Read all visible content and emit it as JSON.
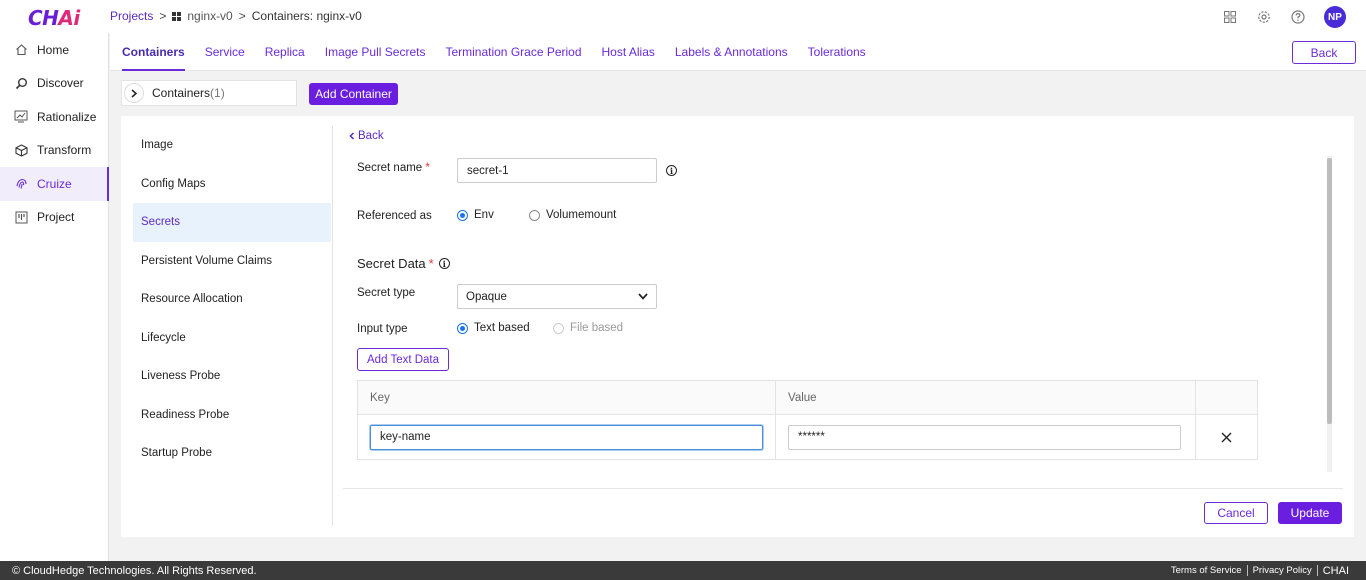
{
  "app": {
    "logo_main": "CH",
    "logo_accent": "Ai"
  },
  "breadcrumb": {
    "projects": "Projects",
    "sep1": ">",
    "project": "nginx-v0",
    "sep2": ">",
    "current": "Containers: nginx-v0"
  },
  "header": {
    "avatar_initials": "NP",
    "icons": [
      "grid-apps-icon",
      "gear-icon",
      "help-icon"
    ]
  },
  "sidebar": {
    "items": [
      {
        "label": "Home",
        "icon": "home-icon"
      },
      {
        "label": "Discover",
        "icon": "search-icon"
      },
      {
        "label": "Rationalize",
        "icon": "chart-icon"
      },
      {
        "label": "Transform",
        "icon": "cube-icon"
      },
      {
        "label": "Cruize",
        "icon": "fingerprint-icon",
        "active": true
      },
      {
        "label": "Project",
        "icon": "kanban-icon"
      }
    ]
  },
  "tabs": {
    "items": [
      "Containers",
      "Service",
      "Replica",
      "Image Pull Secrets",
      "Termination Grace Period",
      "Host Alias",
      "Labels & Annotations",
      "Tolerations"
    ],
    "active": "Containers",
    "back_label": "Back"
  },
  "containers": {
    "label": "Containers",
    "count": "(1)",
    "add_label": "Add Container"
  },
  "subnav": {
    "items": [
      "Image",
      "Config Maps",
      "Secrets",
      "Persistent Volume Claims",
      "Resource Allocation",
      "Lifecycle",
      "Liveness Probe",
      "Readiness Probe",
      "Startup Probe"
    ],
    "active": "Secrets"
  },
  "form": {
    "back_label": "Back",
    "secret_name_label": "Secret name",
    "required_mark": "*",
    "secret_name_value": "secret-1",
    "referenced_as_label": "Referenced as",
    "ref_options": [
      "Env",
      "Volumemount"
    ],
    "ref_selected": "Env",
    "secret_data_title": "Secret Data",
    "secret_type_label": "Secret type",
    "secret_type_value": "Opaque",
    "input_type_label": "Input type",
    "input_options": [
      "Text based",
      "File based"
    ],
    "input_selected": "Text based",
    "add_text_label": "Add Text Data",
    "table": {
      "headers": [
        "Key",
        "Value"
      ],
      "rows": [
        {
          "key": "key-name",
          "value": "******"
        }
      ]
    },
    "cancel_label": "Cancel",
    "update_label": "Update"
  },
  "footer": {
    "copyright": "© CloudHedge Technologies. All Rights Reserved.",
    "terms": "Terms of Service",
    "privacy": "Privacy Policy",
    "brand": "CHAI"
  },
  "colors": {
    "accent": "#6a2bd8",
    "primary_button": "#6a1fe0",
    "radio_checked": "#1a73e8"
  }
}
